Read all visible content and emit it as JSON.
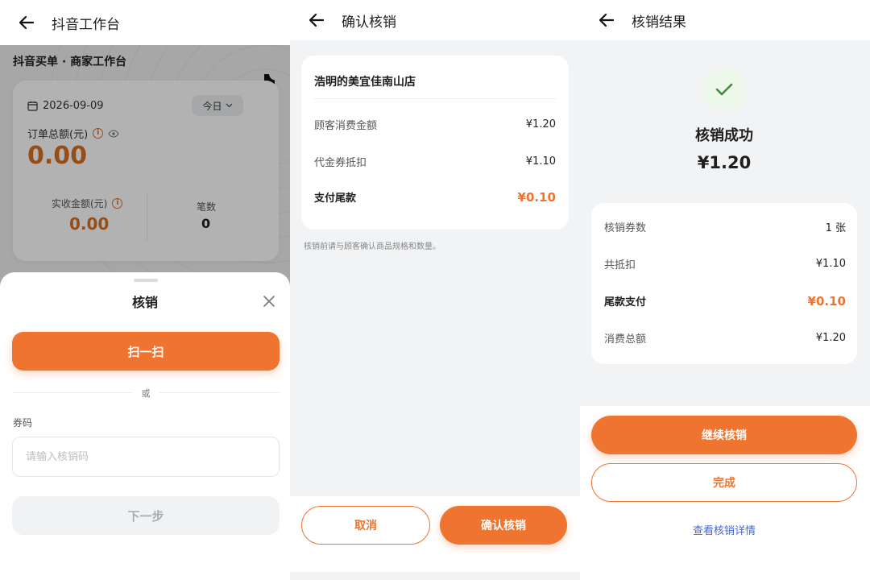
{
  "colors": {
    "accent": "#ee7430",
    "amount": "#d97020",
    "link": "#4a66c9",
    "success_check": "#3f8f3a"
  },
  "panel1": {
    "header_title": "抖音工作台",
    "shop_title": "抖音买单 · 商家工作台",
    "date": "2026-09-09",
    "period_selector": "今日",
    "order_total_label": "订单总额(元)",
    "order_total_value": "0.00",
    "actual_amount_label": "实收金额(元)",
    "actual_amount_value": "0.00",
    "count_label": "笔数",
    "count_value": "0",
    "sheet": {
      "title": "核销",
      "scan_button": "扫一扫",
      "divider_text": "或",
      "code_label": "券码",
      "code_placeholder": "请输入核销码",
      "next_button": "下一步"
    }
  },
  "panel2": {
    "header_title": "确认核销",
    "store_name": "浩明的美宜佳南山店",
    "rows": [
      {
        "label": "顾客消费金额",
        "value": "¥1.20"
      },
      {
        "label": "代金券抵扣",
        "value": "¥1.10"
      },
      {
        "label": "支付尾款",
        "value": "¥0.10"
      }
    ],
    "note": "核销前请与顾客确认商品规格和数量。",
    "cancel_button": "取消",
    "confirm_button": "确认核销"
  },
  "panel3": {
    "header_title": "核销结果",
    "status_title": "核销成功",
    "amount": "¥1.20",
    "rows": [
      {
        "label": "核销券数",
        "value": "1 张"
      },
      {
        "label": "共抵扣",
        "value": "¥1.10"
      },
      {
        "label": "尾款支付",
        "value": "¥0.10"
      },
      {
        "label": "消费总额",
        "value": "¥1.20"
      }
    ],
    "continue_button": "继续核销",
    "done_button": "完成",
    "detail_link": "查看核销详情"
  }
}
